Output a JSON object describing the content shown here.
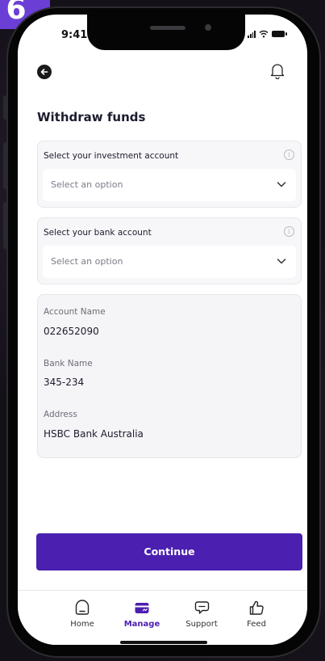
{
  "badge": {
    "text": "6"
  },
  "status_bar": {
    "time": "9:41"
  },
  "header": {
    "back_icon": "arrow-left-icon",
    "bell_icon": "bell-icon"
  },
  "page": {
    "title": "Withdraw funds"
  },
  "investment_select": {
    "label": "Select your investment account",
    "placeholder": "Select an option"
  },
  "bank_select": {
    "label": "Select your bank account",
    "placeholder": "Select an option"
  },
  "account_details": {
    "account_name_label": "Account Name",
    "account_name_value": "022652090",
    "bank_name_label": "Bank Name",
    "bank_name_value": "345-234",
    "address_label": "Address",
    "address_value": "HSBC Bank Australia"
  },
  "continue_button": {
    "label": "Continue"
  },
  "tabs": [
    {
      "label": "Home",
      "icon": "home-icon",
      "active": false
    },
    {
      "label": "Manage",
      "icon": "manage-icon",
      "active": true
    },
    {
      "label": "Support",
      "icon": "support-icon",
      "active": false
    },
    {
      "label": "Feed",
      "icon": "thumbs-up-icon",
      "active": false
    }
  ],
  "colors": {
    "accent": "#4b1fb0",
    "badge": "#6b3fd6",
    "text": "#1c1c2e"
  }
}
